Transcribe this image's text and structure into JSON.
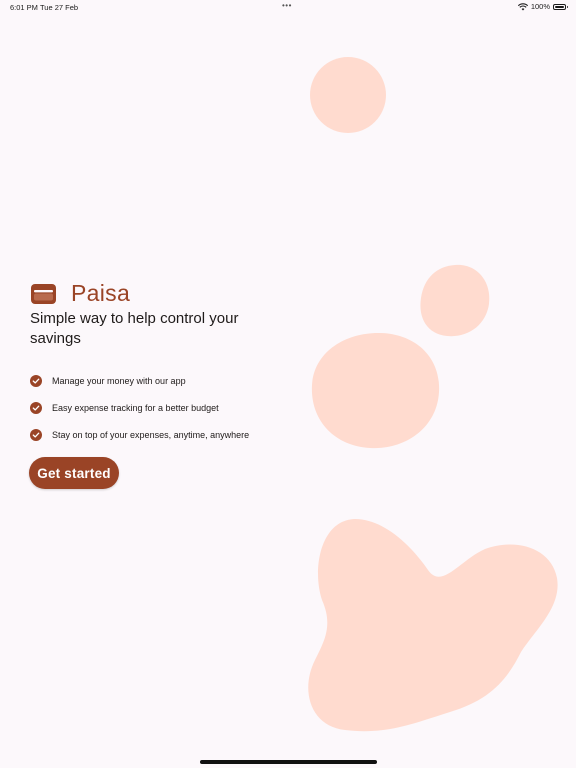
{
  "status_bar": {
    "time": "6:01 PM",
    "date": "Tue 27 Feb",
    "dots": "•••",
    "battery": "100%"
  },
  "brand": {
    "name": "Paisa",
    "icon": "wallet-icon"
  },
  "tagline": "Simple way to help control your savings",
  "features": [
    {
      "text": "Manage your money with our app",
      "icon": "check-circle-icon"
    },
    {
      "text": "Easy expense tracking for a better budget",
      "icon": "check-circle-icon"
    },
    {
      "text": "Stay on top of your expenses, anytime, anywhere",
      "icon": "check-circle-icon"
    }
  ],
  "cta": {
    "label": "Get started"
  },
  "colors": {
    "accent": "#9a4426",
    "background": "#fcf8fb",
    "blob": "#ffdbcf",
    "text": "#1f1b1a"
  }
}
